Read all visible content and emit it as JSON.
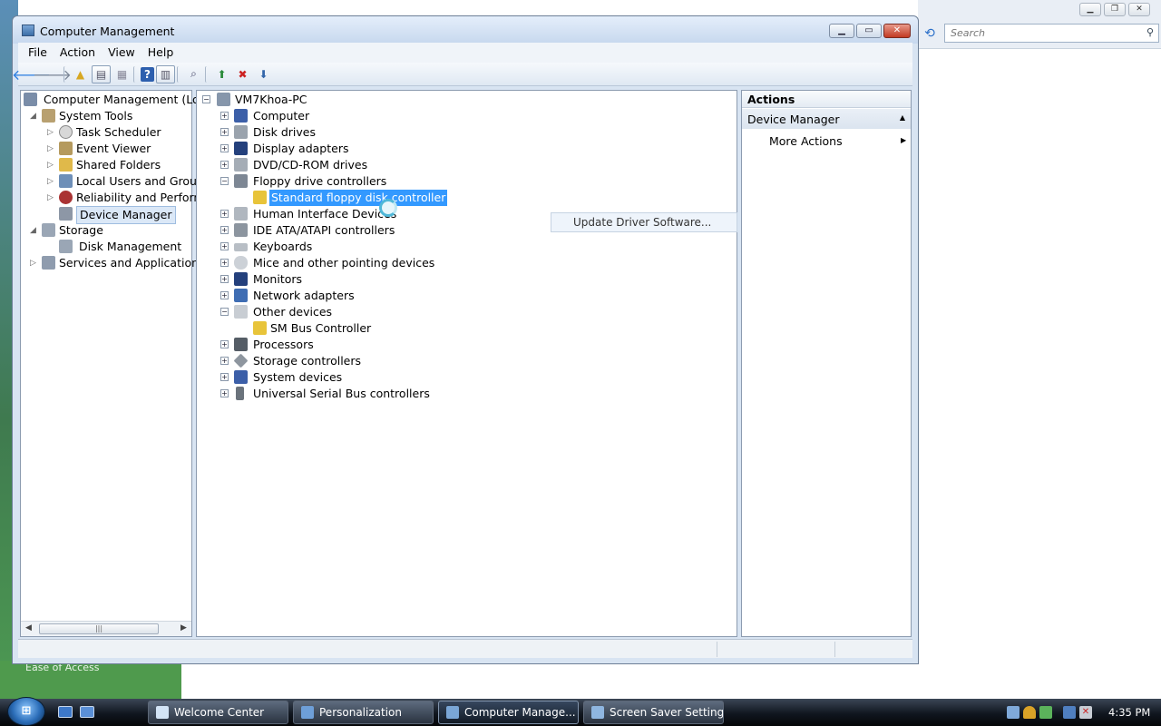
{
  "background_window": {
    "search_placeholder": "Search",
    "controls": [
      "▁",
      "❐",
      "✕"
    ]
  },
  "desktop": {
    "ease_of_access": "Ease of Access"
  },
  "window": {
    "title": "Computer Management",
    "controls": {
      "minimize": "▁",
      "maximize": "▭",
      "close": "✕"
    }
  },
  "menu": [
    "File",
    "Action",
    "View",
    "Help"
  ],
  "left_tree": {
    "root": "Computer Management (Local",
    "system_tools": "System Tools",
    "items": [
      "Task Scheduler",
      "Event Viewer",
      "Shared Folders",
      "Local Users and Groups",
      "Reliability and Performa",
      "Device Manager"
    ],
    "storage": "Storage",
    "disk_management": "Disk Management",
    "services": "Services and Applications",
    "scroll_thumb": "|||"
  },
  "device_tree": {
    "computer_name": "VM7Khoa-PC",
    "categories": [
      "Computer",
      "Disk drives",
      "Display adapters",
      "DVD/CD-ROM drives",
      "Floppy drive controllers",
      "Standard floppy disk controller",
      "Human Interface Devices",
      "IDE ATA/ATAPI controllers",
      "Keyboards",
      "Mice and other pointing devices",
      "Monitors",
      "Network adapters",
      "Other devices",
      "SM Bus Controller",
      "Processors",
      "Storage controllers",
      "System devices",
      "Universal Serial Bus controllers"
    ]
  },
  "context_menu": {
    "item": "Update Driver Software..."
  },
  "actions": {
    "header": "Actions",
    "group": "Device Manager",
    "more": "More Actions"
  },
  "taskbar": {
    "start": "⊞",
    "tasks": [
      "Welcome Center",
      "Personalization",
      "Computer Manage...",
      "Screen Saver Settings"
    ],
    "clock": "4:35 PM"
  },
  "colors": {
    "selection": "#3399ff",
    "title_bar": "#c7d8ee",
    "taskbar": "#10161f"
  }
}
